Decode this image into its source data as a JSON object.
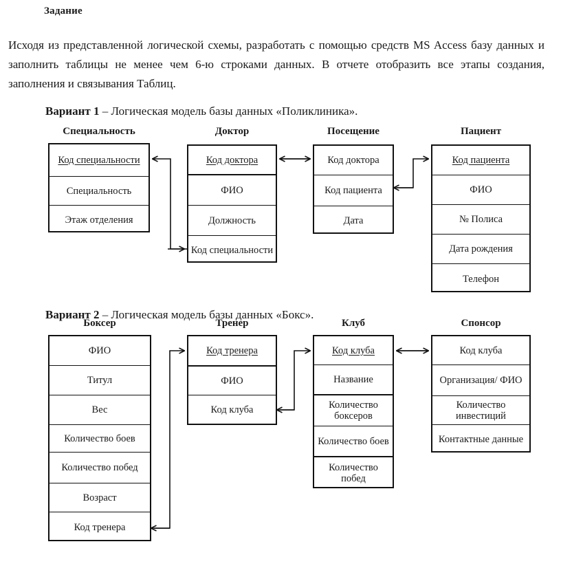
{
  "document": {
    "heading": "Задание",
    "intro": "Исходя из представленной логической схемы, разработать с помощью средств MS Access базу данных и заполнить таблицы не менее чем 6-ю строками данных. В отчете отобразить все этапы создания, заполнения и связывания Таблиц."
  },
  "variants": [
    {
      "label": "Вариант 1",
      "caption_rest": " – Логическая модель базы данных «Поликлиника».",
      "entities": [
        {
          "name": "Специальность",
          "fields": [
            "Код специальности",
            "Специальность",
            "Этаж отделения"
          ]
        },
        {
          "name": "Доктор",
          "fields": [
            "Код доктора",
            "ФИО",
            "Должность",
            "Код специальности"
          ]
        },
        {
          "name": "Посещение",
          "fields": [
            "Код доктора",
            "Код пациента",
            "Дата"
          ]
        },
        {
          "name": "Пациент",
          "fields": [
            "Код пациента",
            "ФИО",
            "№ Полиса",
            "Дата рождения",
            "Телефон"
          ]
        }
      ]
    },
    {
      "label": "Вариант 2",
      "caption_rest": " – Логическая модель базы данных «Бокс».",
      "entities": [
        {
          "name": "Боксер",
          "fields": [
            "ФИО",
            "Титул",
            "Вес",
            "Количество боев",
            "Количество побед",
            "Возраст",
            "Код тренера"
          ]
        },
        {
          "name": "Тренер",
          "fields": [
            "Код тренера",
            "ФИО",
            "Код клуба"
          ]
        },
        {
          "name": "Клуб",
          "fields": [
            "Код клуба",
            "Название",
            "Количество боксеров",
            "Количество боев",
            "Количество побед"
          ]
        },
        {
          "name": "Спонсор",
          "fields": [
            "Код клуба",
            "Организация/ ФИО",
            "Количество инвестиций",
            "Контактные данные"
          ]
        }
      ]
    }
  ],
  "colors": {
    "ink": "#111111",
    "page": "#ffffff"
  }
}
